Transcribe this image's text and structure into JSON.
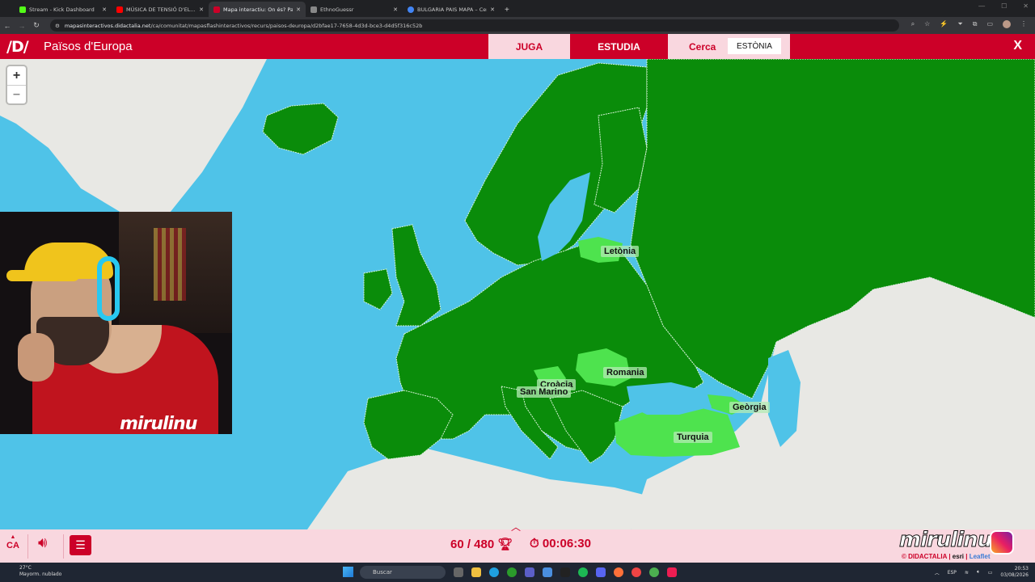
{
  "browser": {
    "tabs": [
      {
        "label": "Stream - Kick Dashboard",
        "color": "#53fc18",
        "active": false
      },
      {
        "label": "MÚSICA DE TENSIÓ D'EL...",
        "color": "#ff0000",
        "active": false
      },
      {
        "label": "Mapa interactiu: On és? Països...",
        "color": "#cc0028",
        "active": true
      },
      {
        "label": "EthnoGuessr",
        "color": "#888888",
        "active": false
      },
      {
        "label": "BULGARIA PAIS MAPA – Cerca...",
        "color": "#4285f4",
        "active": false
      }
    ],
    "url_host": "mapasinteractivos.didactalia.net",
    "url_path": "/ca/comunitat/mapasflashinteractivos/recurs/paisos-deuropa/d2bfae17-7658-4d3d-bce3-d4d5f316c52b"
  },
  "header": {
    "logo": "/D/",
    "title": "Països d'Europa",
    "play_label": "JUGA",
    "study_label": "ESTUDIA",
    "find_label": "Cerca",
    "target_country": "ESTÒNIA",
    "close_label": "X"
  },
  "map": {
    "zoom_in": "+",
    "zoom_out": "–",
    "labels": {
      "latvia": "Letònia",
      "romania": "Romania",
      "croatia": "Croàcia",
      "san_marino": "San Marino",
      "georgia": "Geòrgia",
      "turkey": "Turquia"
    },
    "colors": {
      "sea": "#4fc3e8",
      "found": "#0a8c0a",
      "highlight": "#4ee34e",
      "land_other": "#e8e8e4"
    }
  },
  "webcam": {
    "overlay_name": "mirulinu"
  },
  "footer": {
    "lang": "CA",
    "score": "60 / 480",
    "timer": "00:06:30",
    "brand": "mirulinu",
    "credits_a": "© DIDACTALIA",
    "credits_b": "esri",
    "credits_c": "Leaflet"
  },
  "taskbar": {
    "temp": "27°C",
    "weather": "Mayorm. nublado",
    "search": "Buscar",
    "lang": "ESP",
    "time": "20:53",
    "date": "03/08/2026"
  }
}
